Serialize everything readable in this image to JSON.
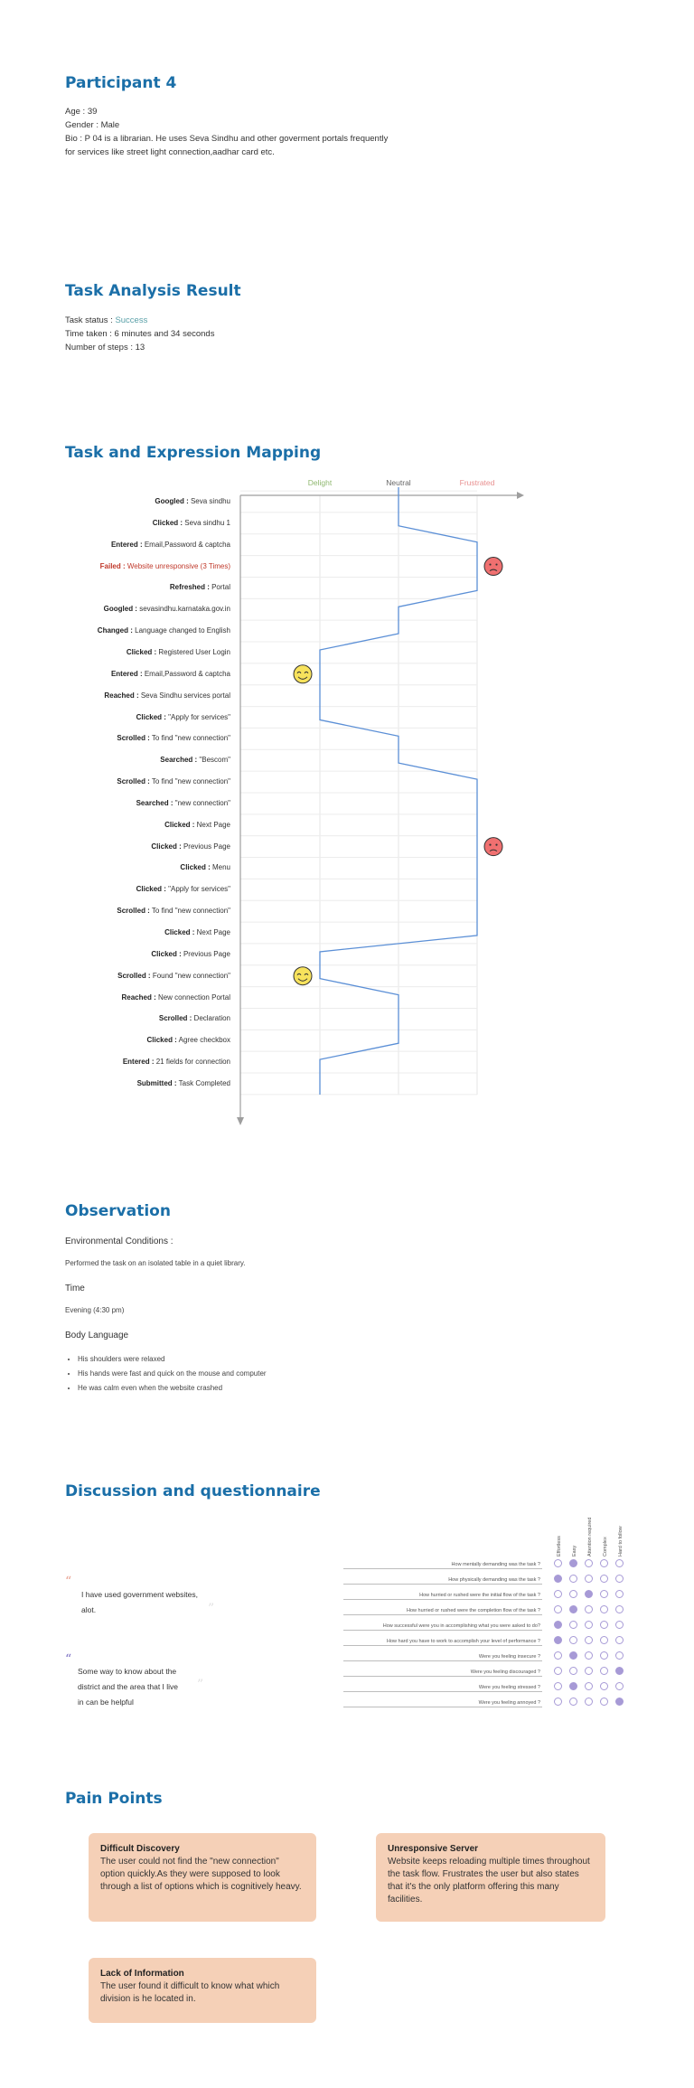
{
  "participant": {
    "title": "Participant 4",
    "age": "Age : 39",
    "gender": "Gender : Male",
    "bio_line1": "Bio :  P 04 is a librarian. He uses Seva Sindhu and other goverment portals  frequently",
    "bio_line2": "for services like street light connection,aadhar card etc."
  },
  "task_analysis": {
    "title": "Task Analysis Result",
    "status_label": "Task status : ",
    "status_value": "Success",
    "time_taken": "Time taken : 6 minutes and 34 seconds",
    "steps": "Number of steps : 13"
  },
  "mapping": {
    "title": "Task and Expression Mapping",
    "columns": [
      "Delight",
      "Neutral",
      "Frustrated"
    ],
    "column_colors": [
      "#8fb86f",
      "#666666",
      "#e88f8f"
    ],
    "rows": [
      {
        "verb": "Googled :",
        "text": " Seva sindhu",
        "level": 1
      },
      {
        "verb": "Clicked :",
        "text": " Seva sindhu 1",
        "level": 1
      },
      {
        "verb": "Entered :",
        "text": " Email,Password & captcha",
        "level": 2
      },
      {
        "verb": "Failed :",
        "text": " Website unresponsive (3 Times)",
        "level": 2,
        "failed": true
      },
      {
        "verb": "Refreshed :",
        "text": " Portal",
        "level": 2
      },
      {
        "verb": "Googled :",
        "text": " sevasindhu.karnataka.gov.in",
        "level": 1
      },
      {
        "verb": "Changed :",
        "text": " Language changed to English",
        "level": 1
      },
      {
        "verb": "Clicked :",
        "text": " Registered User Login",
        "level": 0
      },
      {
        "verb": "Entered :",
        "text": " Email,Password & captcha",
        "level": 0
      },
      {
        "verb": "Reached :",
        "text": " Seva Sindhu services portal",
        "level": 0
      },
      {
        "verb": "Clicked :",
        "text": " \"Apply for services\"",
        "level": 0
      },
      {
        "verb": "Scrolled :",
        "text": " To find \"new connection\"",
        "level": 1
      },
      {
        "verb": "Searched :",
        "text": " \"Bescom\"",
        "level": 1
      },
      {
        "verb": "Scrolled :",
        "text": " To find \"new connection\"",
        "level": 2
      },
      {
        "verb": "Searched :",
        "text": "  \"new connection\"",
        "level": 2
      },
      {
        "verb": "Clicked :",
        "text": " Next Page",
        "level": 2
      },
      {
        "verb": "Clicked :",
        "text": " Previous Page",
        "level": 2
      },
      {
        "verb": "Clicked :",
        "text": " Menu",
        "level": 2
      },
      {
        "verb": "Clicked :",
        "text": " \"Apply for services\"",
        "level": 2
      },
      {
        "verb": "Scrolled :",
        "text": " To find \"new connection\"",
        "level": 2
      },
      {
        "verb": "Clicked :",
        "text": " Next Page",
        "level": 2
      },
      {
        "verb": "Clicked :",
        "text": " Previous Page",
        "level": 0
      },
      {
        "verb": "Scrolled :",
        "text": " Found  \"new connection\"",
        "level": 0
      },
      {
        "verb": "Reached :",
        "text": " New connection Portal",
        "level": 1
      },
      {
        "verb": "Scrolled :",
        "text": " Declaration",
        "level": 1
      },
      {
        "verb": "Clicked :",
        "text": " Agree checkbox",
        "level": 1
      },
      {
        "verb": "Entered :",
        "text": " 21 fields for connection",
        "level": 0
      },
      {
        "verb": "Submitted :",
        "text": " Task Completed",
        "level": 0
      }
    ],
    "emojis": [
      {
        "type": "frustrated",
        "row": 3
      },
      {
        "type": "delight",
        "row": 8
      },
      {
        "type": "frustrated",
        "row": 16
      },
      {
        "type": "delight",
        "row": 22
      }
    ]
  },
  "observation": {
    "title": "Observation",
    "env_heading": "Environmental Conditions :",
    "env_text": "Performed the task on an isolated table in a quiet library.",
    "time_heading": "Time",
    "time_text": "Evening (4:30 pm)",
    "body_heading": "Body Language",
    "body_items": [
      "His shoulders were relaxed",
      "His hands were fast and quick on the mouse and computer",
      "He was calm even when the website crashed"
    ]
  },
  "discussion": {
    "title": "Discussion and questionnaire",
    "quote1_line1": "I have used government websites,",
    "quote1_line2": "alot.",
    "quote2_line1": "Some way to know about the",
    "quote2_line2": "district and the area that I live",
    "quote2_line3": "in can be helpful",
    "quote_color": "#e8a090",
    "quote2_color": "#7a6fc2",
    "columns": [
      "Effortless",
      "Easy",
      "Attention required",
      "Complex",
      "Hard to follow"
    ],
    "questions": [
      {
        "q": "How mentally demanding was the task ?",
        "selected": 1
      },
      {
        "q": "How physically demanding was the task ?",
        "selected": 0
      },
      {
        "q": "How hurried or rushed were the initial flow of the task ?",
        "selected": 2
      },
      {
        "q": "How hurried or rushed were the completion flow of the task ?",
        "selected": 1
      },
      {
        "q": "How successful were you in accomplishing what you were asked to do?",
        "selected": 0
      },
      {
        "q": "How hard you have to work to accomplish your level of performance ?",
        "selected": 0
      },
      {
        "q": "Were you feeling insecure ?",
        "selected": 1
      },
      {
        "q": "Were you feeling discouraged ?",
        "selected": 4
      },
      {
        "q": "Were you feeling stressed ?",
        "selected": 1
      },
      {
        "q": "Were you feeling annoyed ?",
        "selected": 4
      }
    ]
  },
  "pain_points": {
    "title": "Pain Points",
    "cards": [
      {
        "title": "Difficult Discovery",
        "body": "The user could not find the \"new connection\" option quickly.As they were supposed to look through a list of options which is cognitively heavy."
      },
      {
        "title": "Unresponsive Server",
        "body": "Website keeps reloading multiple times throughout the task flow. Frustrates the user but also states that it's the only platform offering this many facilities."
      },
      {
        "title": "Lack of Information",
        "body": "The user found it difficult to know what which division is he located in."
      }
    ]
  }
}
